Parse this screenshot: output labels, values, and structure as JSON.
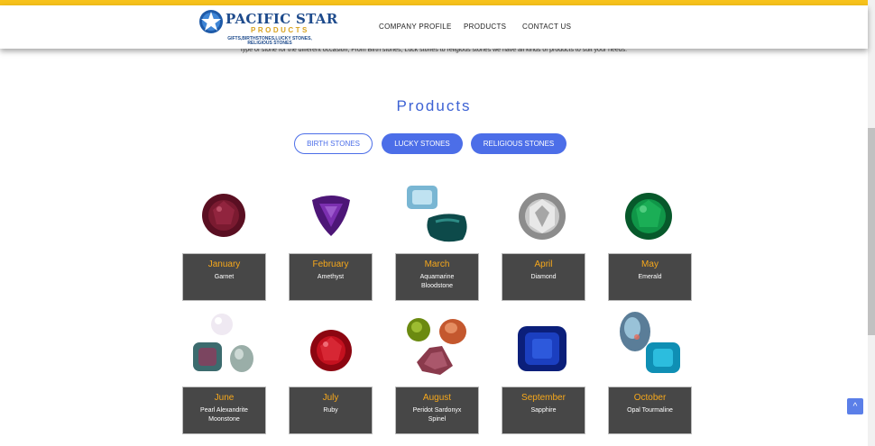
{
  "brand": {
    "name": "PACIFIC STAR",
    "subname": "PRODUCTS",
    "tagline_line1": "GIFTS,BIRTHSTONES,LUCKY STONES,",
    "tagline_line2": "RELIGIOUS STONES",
    "accent_color": "#f7c21b",
    "primary_color": "#4c6ee8"
  },
  "nav": {
    "company_profile": "COMPANY PROFILE",
    "products": "PRODUCTS",
    "contact_us": "CONTACT US"
  },
  "intro_text": "type of stone for the different occasion; From Birth stones, Luck stones to religious stones we have all kinds of products to suit your needs.",
  "section_title": "Products",
  "tabs": {
    "birth": "BIRTH STONES",
    "lucky": "LUCKY STONES",
    "religious": "RELIGIOUS STONES"
  },
  "months": [
    {
      "month": "January",
      "stones": [
        "Garnet"
      ]
    },
    {
      "month": "February",
      "stones": [
        "Amethyst"
      ]
    },
    {
      "month": "March",
      "stones": [
        "Aquamarine",
        "Bloodstone"
      ]
    },
    {
      "month": "April",
      "stones": [
        "Diamond"
      ]
    },
    {
      "month": "May",
      "stones": [
        "Emerald"
      ]
    },
    {
      "month": "June",
      "stones": [
        "Pearl Alexandrite",
        "Moonstone"
      ]
    },
    {
      "month": "July",
      "stones": [
        "Ruby"
      ]
    },
    {
      "month": "August",
      "stones": [
        "Peridot Sardonyx",
        "Spinel"
      ]
    },
    {
      "month": "September",
      "stones": [
        "Sapphire"
      ]
    },
    {
      "month": "October",
      "stones": [
        "Opal Tourmaline"
      ]
    }
  ],
  "icons": {
    "back_to_top": "chevron-up-icon",
    "back_to_top_glyph": "^"
  }
}
